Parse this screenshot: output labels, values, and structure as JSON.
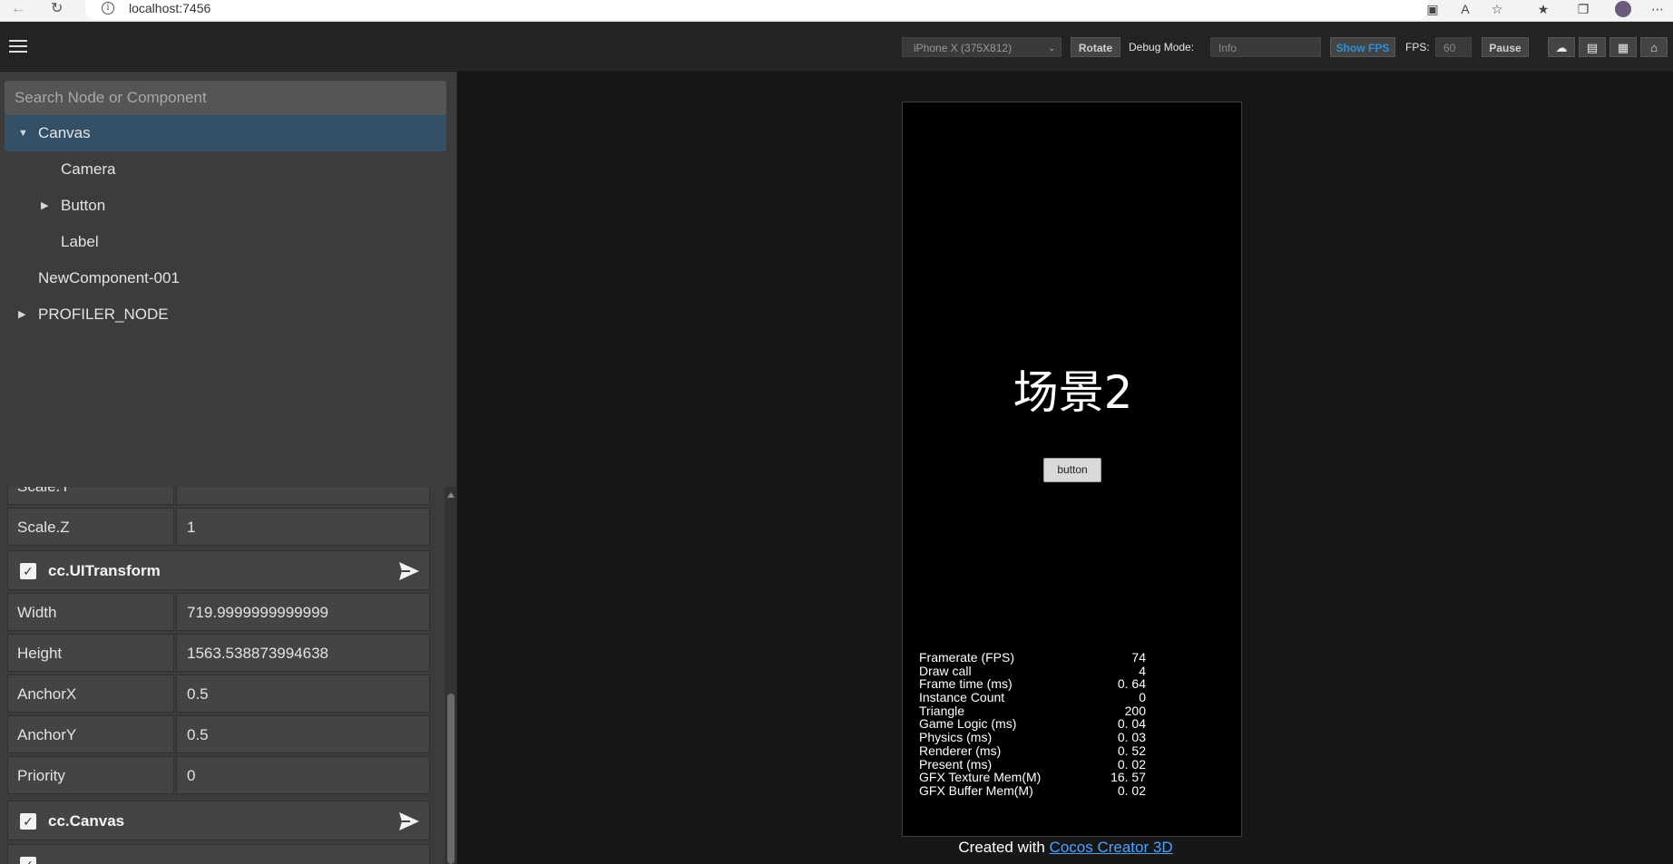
{
  "browser": {
    "url": "localhost:7456"
  },
  "toolbar": {
    "device_select": "iPhone X (375X812)",
    "rotate_label": "Rotate",
    "debug_mode_label": "Debug Mode:",
    "debug_mode_value": "Info",
    "show_fps_label": "Show FPS",
    "fps_label": "FPS:",
    "fps_value": "60",
    "pause_label": "Pause",
    "show_fps_color": "#2f8fd6"
  },
  "hierarchy": {
    "search_placeholder": "Search Node or Component",
    "nodes": [
      {
        "label": "Canvas",
        "expanded": true,
        "selected": true
      },
      {
        "label": "Camera"
      },
      {
        "label": "Button",
        "expanded": false
      },
      {
        "label": "Label"
      },
      {
        "label": "NewComponent-001"
      },
      {
        "label": "PROFILER_NODE",
        "expanded": false
      }
    ]
  },
  "inspector": {
    "partial_label": "Scale.Y",
    "scale_z": {
      "label": "Scale.Z",
      "value": "1"
    },
    "ui_transform": {
      "title": "cc.UITransform",
      "props": [
        {
          "label": "Width",
          "value": "719.9999999999999"
        },
        {
          "label": "Height",
          "value": "1563.538873994638"
        },
        {
          "label": "AnchorX",
          "value": "0.5"
        },
        {
          "label": "AnchorY",
          "value": "0.5"
        },
        {
          "label": "Priority",
          "value": "0"
        }
      ]
    },
    "canvas_component": {
      "title": "cc.Canvas"
    }
  },
  "game": {
    "scene_title": "场景2",
    "button_label": "button",
    "stats": [
      {
        "label": "Framerate (FPS)",
        "value": "74"
      },
      {
        "label": "Draw call",
        "value": "4"
      },
      {
        "label": "Frame time (ms)",
        "value": "0. 64"
      },
      {
        "label": "Instance Count",
        "value": "0"
      },
      {
        "label": "Triangle",
        "value": "200"
      },
      {
        "label": "Game Logic (ms)",
        "value": "0. 04"
      },
      {
        "label": "Physics (ms)",
        "value": "0. 03"
      },
      {
        "label": "Renderer (ms)",
        "value": "0. 52"
      },
      {
        "label": "Present (ms)",
        "value": "0. 02"
      },
      {
        "label": "GFX Texture Mem(M)",
        "value": "16. 57"
      },
      {
        "label": "GFX Buffer Mem(M)",
        "value": "0. 02"
      }
    ]
  },
  "footer": {
    "prefix": "Created with",
    "link": "Cocos Creator 3D"
  }
}
